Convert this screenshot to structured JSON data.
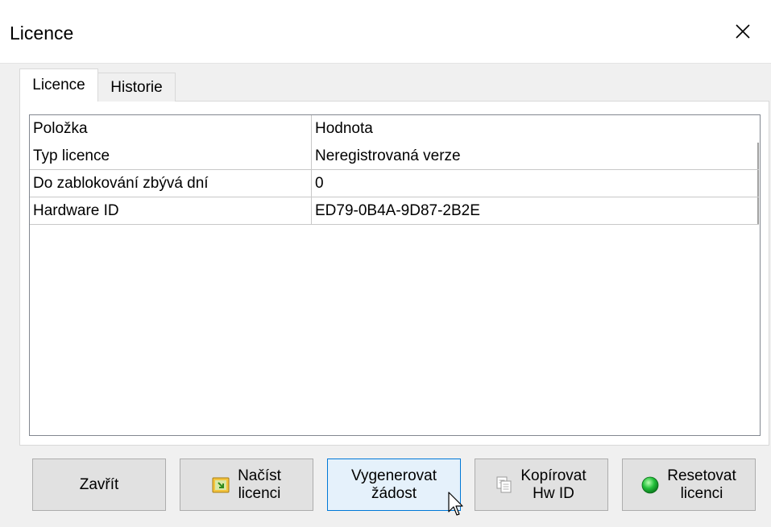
{
  "window": {
    "title": "Licence",
    "close_glyph": "✕"
  },
  "tabs": [
    {
      "label": "Licence",
      "active": true
    },
    {
      "label": "Historie",
      "active": false
    }
  ],
  "grid": {
    "headers": [
      "Položka",
      "Hodnota"
    ],
    "rows": [
      [
        "Typ licence",
        "Neregistrovaná verze"
      ],
      [
        "Do zablokování zbývá dní",
        "0"
      ],
      [
        "Hardware ID",
        "ED79-0B4A-9D87-2B2E"
      ]
    ]
  },
  "buttons": {
    "close": {
      "label": "Zavřít"
    },
    "load": {
      "line1": "Načíst",
      "line2": "licenci",
      "icon": "load-license-icon"
    },
    "generate": {
      "line1": "Vygenerovat",
      "line2": "žádost"
    },
    "copy": {
      "line1": "Kopírovat",
      "line2": "Hw ID",
      "icon": "copy-icon"
    },
    "reset": {
      "line1": "Resetovat",
      "line2": "licenci",
      "icon": "green-status-icon"
    }
  },
  "colors": {
    "accent": "#0078d7",
    "button_hover_bg": "#e5f1fb",
    "status_green": "#22c03a"
  }
}
